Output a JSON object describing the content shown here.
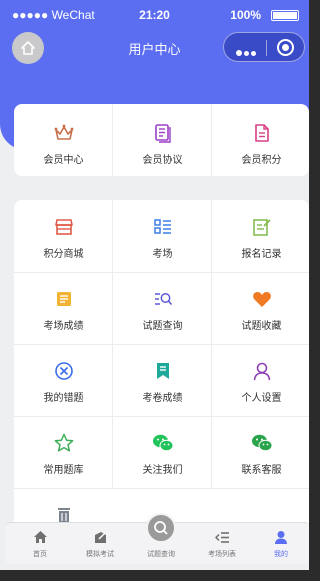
{
  "status": {
    "signal": "●●●●● WeChat",
    "time": "21:20",
    "battery": "100%"
  },
  "nav": {
    "title": "用户中心"
  },
  "top_menu": [
    {
      "label": "会员中心",
      "icon": "crown-icon",
      "color": "#c8704a"
    },
    {
      "label": "会员协议",
      "icon": "document-icon",
      "color": "#9b3ec8"
    },
    {
      "label": "会员积分",
      "icon": "points-doc-icon",
      "color": "#d93f86"
    }
  ],
  "grid_menu": [
    {
      "label": "积分商城",
      "icon": "store-icon",
      "color": "#e05a4a"
    },
    {
      "label": "考场",
      "icon": "list-icon",
      "color": "#3b7de8"
    },
    {
      "label": "报名记录",
      "icon": "edit-note-icon",
      "color": "#7fb94a"
    },
    {
      "label": "考场成绩",
      "icon": "score-card-icon",
      "color": "#f2b233"
    },
    {
      "label": "试题查询",
      "icon": "search-list-icon",
      "color": "#5b5bd6"
    },
    {
      "label": "试题收藏",
      "icon": "heart-icon",
      "color": "#f07a23"
    },
    {
      "label": "我的错题",
      "icon": "error-circle-icon",
      "color": "#3b6ee8"
    },
    {
      "label": "考卷成绩",
      "icon": "bookmark-icon",
      "color": "#1fa99a"
    },
    {
      "label": "个人设置",
      "icon": "user-icon",
      "color": "#8e3fb5"
    },
    {
      "label": "常用题库",
      "icon": "star-icon",
      "color": "#3fae5a"
    },
    {
      "label": "关注我们",
      "icon": "wechat-icon",
      "color": "#22c35a"
    },
    {
      "label": "联系客服",
      "icon": "wechat-service-icon",
      "color": "#2aa44a"
    },
    {
      "label": "",
      "icon": "trash-icon",
      "color": "#7b8590"
    }
  ],
  "tabbar": [
    {
      "label": "首页",
      "icon": "home-icon"
    },
    {
      "label": "模拟考试",
      "icon": "exam-icon"
    },
    {
      "label": "试题查询",
      "icon": "search-icon"
    },
    {
      "label": "考场列表",
      "icon": "list-arrow-icon"
    },
    {
      "label": "我的",
      "icon": "person-icon",
      "active": true
    }
  ],
  "colors": {
    "primary": "#5b6ef2",
    "background": "#eeeff1"
  }
}
